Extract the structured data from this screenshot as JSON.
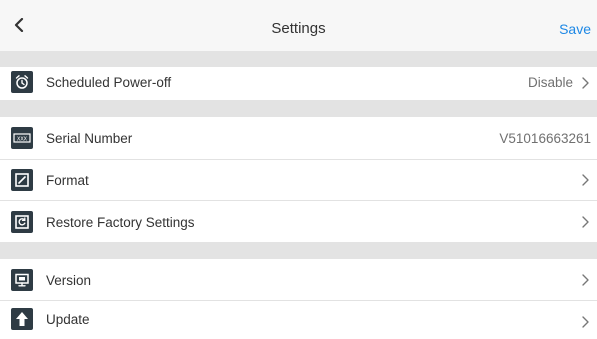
{
  "header": {
    "title": "Settings",
    "save_label": "Save",
    "back_icon": "chevron-left-icon"
  },
  "rows": [
    {
      "label": "Scheduled Power-off",
      "value": "Disable",
      "icon": "alarm-clock-icon",
      "arrow": true
    },
    {
      "label": "Serial Number",
      "value": "V51016663261",
      "icon": "serial-number-icon",
      "arrow": false
    },
    {
      "label": "Format",
      "value": "",
      "icon": "format-icon",
      "arrow": true
    },
    {
      "label": "Restore Factory Settings",
      "value": "",
      "icon": "restore-icon",
      "arrow": true
    },
    {
      "label": "Version",
      "value": "",
      "icon": "version-icon",
      "arrow": true
    },
    {
      "label": "Update",
      "value": "",
      "icon": "upload-arrow-icon",
      "arrow": true
    }
  ],
  "colors": {
    "accent": "#1e88e5",
    "icon_bg": "#2e3b44",
    "section_gap": "#e3e3e3",
    "header_bg": "#f7f7f7"
  }
}
